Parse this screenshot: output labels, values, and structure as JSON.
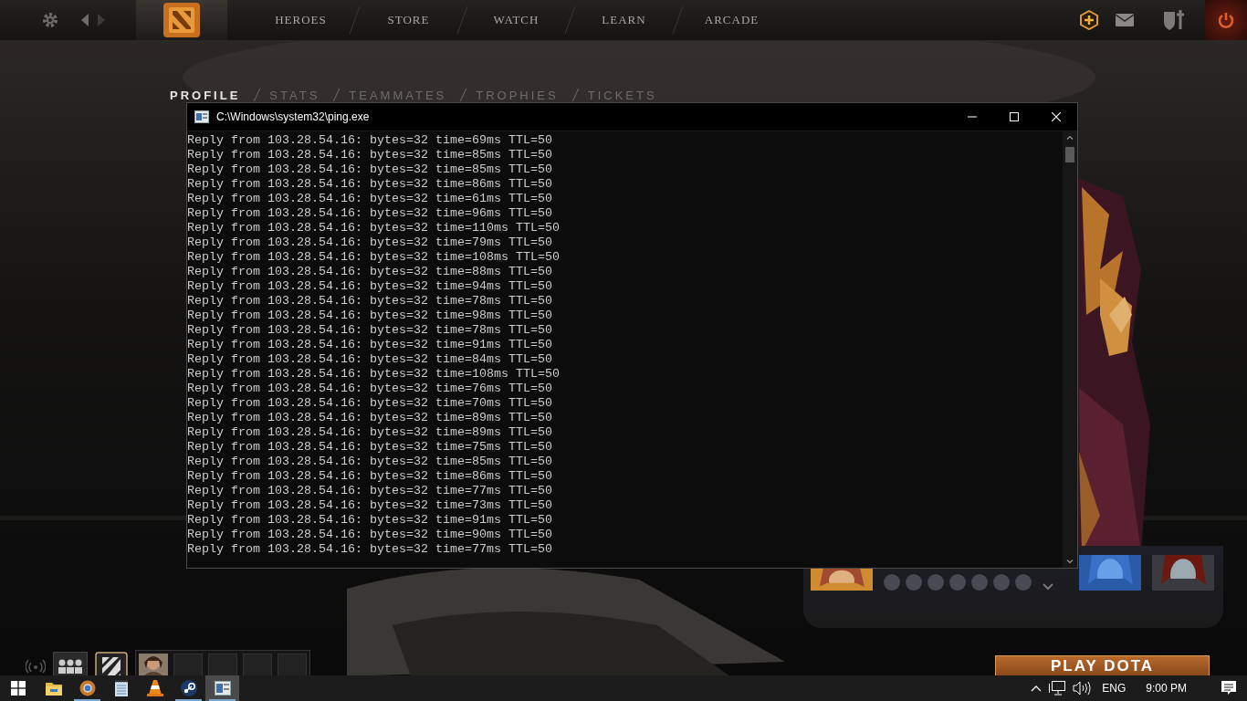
{
  "top_nav": {
    "tabs": [
      {
        "label": "HEROES",
        "selected": false
      },
      {
        "label": "STORE",
        "selected": false
      },
      {
        "label": "WATCH",
        "selected": false
      },
      {
        "label": "LEARN",
        "selected": false
      },
      {
        "label": "ARCADE",
        "selected": false
      }
    ]
  },
  "profile_tabs": [
    {
      "label": "PROFILE",
      "selected": true
    },
    {
      "label": "STATS",
      "selected": false
    },
    {
      "label": "TEAMMATES",
      "selected": false
    },
    {
      "label": "TROPHIES",
      "selected": false
    },
    {
      "label": "TICKETS",
      "selected": false
    }
  ],
  "console": {
    "title": "C:\\Windows\\system32\\ping.exe",
    "lines": [
      "Reply from 103.28.54.16: bytes=32 time=69ms TTL=50",
      "Reply from 103.28.54.16: bytes=32 time=85ms TTL=50",
      "Reply from 103.28.54.16: bytes=32 time=85ms TTL=50",
      "Reply from 103.28.54.16: bytes=32 time=86ms TTL=50",
      "Reply from 103.28.54.16: bytes=32 time=61ms TTL=50",
      "Reply from 103.28.54.16: bytes=32 time=96ms TTL=50",
      "Reply from 103.28.54.16: bytes=32 time=110ms TTL=50",
      "Reply from 103.28.54.16: bytes=32 time=79ms TTL=50",
      "Reply from 103.28.54.16: bytes=32 time=108ms TTL=50",
      "Reply from 103.28.54.16: bytes=32 time=88ms TTL=50",
      "Reply from 103.28.54.16: bytes=32 time=94ms TTL=50",
      "Reply from 103.28.54.16: bytes=32 time=78ms TTL=50",
      "Reply from 103.28.54.16: bytes=32 time=98ms TTL=50",
      "Reply from 103.28.54.16: bytes=32 time=78ms TTL=50",
      "Reply from 103.28.54.16: bytes=32 time=91ms TTL=50",
      "Reply from 103.28.54.16: bytes=32 time=84ms TTL=50",
      "Reply from 103.28.54.16: bytes=32 time=108ms TTL=50",
      "Reply from 103.28.54.16: bytes=32 time=76ms TTL=50",
      "Reply from 103.28.54.16: bytes=32 time=70ms TTL=50",
      "Reply from 103.28.54.16: bytes=32 time=89ms TTL=50",
      "Reply from 103.28.54.16: bytes=32 time=89ms TTL=50",
      "Reply from 103.28.54.16: bytes=32 time=75ms TTL=50",
      "Reply from 103.28.54.16: bytes=32 time=85ms TTL=50",
      "Reply from 103.28.54.16: bytes=32 time=86ms TTL=50",
      "Reply from 103.28.54.16: bytes=32 time=77ms TTL=50",
      "Reply from 103.28.54.16: bytes=32 time=73ms TTL=50",
      "Reply from 103.28.54.16: bytes=32 time=91ms TTL=50",
      "Reply from 103.28.54.16: bytes=32 time=90ms TTL=50",
      "Reply from 103.28.54.16: bytes=32 time=77ms TTL=50"
    ]
  },
  "play_button": {
    "label": "PLAY DOTA"
  },
  "taskbar": {
    "apps": [
      {
        "kind": "folder",
        "running": false,
        "active": false
      },
      {
        "kind": "browser",
        "running": true,
        "active": false
      },
      {
        "kind": "notepad",
        "running": false,
        "active": false
      },
      {
        "kind": "cone",
        "running": false,
        "active": false
      },
      {
        "kind": "steam",
        "running": true,
        "active": false
      },
      {
        "kind": "console",
        "running": true,
        "active": true
      }
    ],
    "tray": {
      "language": "ENG",
      "time": "9:00 PM"
    }
  }
}
